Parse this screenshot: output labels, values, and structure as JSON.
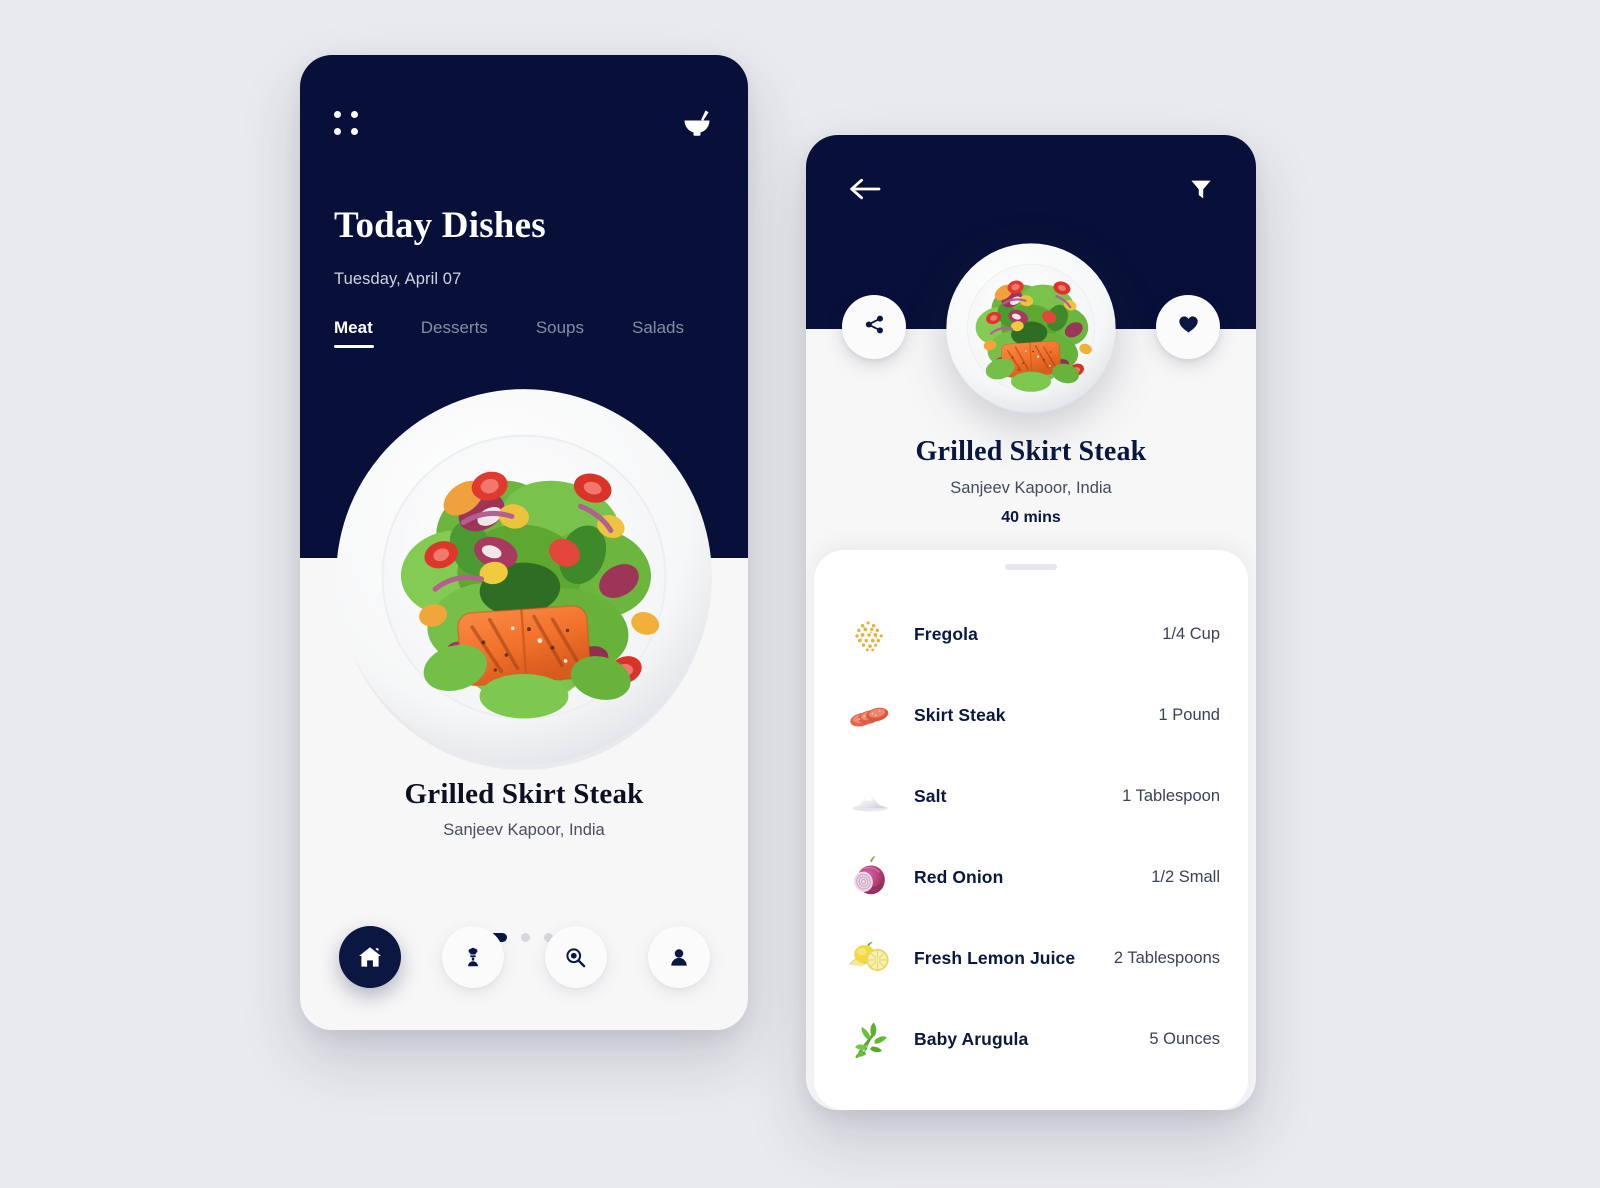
{
  "theme": {
    "navy": "#081039",
    "navy_text": "#0b1740",
    "page_bg": "#e9eaee",
    "card_bg": "#f7f7f8",
    "muted_tab": "#848da8"
  },
  "home_screen": {
    "menu_icon": "grid-dots-icon",
    "bowl_icon": "bowl-with-spoon-icon",
    "title": "Today Dishes",
    "date": "Tuesday, April 07",
    "tabs": [
      {
        "label": "Meat",
        "active": true
      },
      {
        "label": "Desserts",
        "active": false
      },
      {
        "label": "Soups",
        "active": false
      },
      {
        "label": "Salads",
        "active": false
      }
    ],
    "dish": {
      "name": "Grilled Skirt Steak",
      "author": "Sanjeev Kapoor, India",
      "image_alt": "grilled-salmon-salad-plate"
    },
    "carousel": {
      "total": 4,
      "active_index": 0
    },
    "bottom_nav": [
      {
        "icon": "home-icon",
        "active": true
      },
      {
        "icon": "chef-icon",
        "active": false
      },
      {
        "icon": "search-icon",
        "active": false
      },
      {
        "icon": "profile-icon",
        "active": false
      }
    ]
  },
  "detail_screen": {
    "back_icon": "arrow-left-icon",
    "filter_icon": "filter-funnel-icon",
    "share_icon": "share-icon",
    "favorite_icon": "heart-icon",
    "dish": {
      "name": "Grilled Skirt Steak",
      "author": "Sanjeev Kapoor, India",
      "time": "40 mins",
      "image_alt": "grilled-salmon-salad-plate"
    },
    "ingredients": [
      {
        "icon": "fregola-icon",
        "name": "Fregola",
        "quantity": "1/4 Cup"
      },
      {
        "icon": "skirt-steak-icon",
        "name": "Skirt Steak",
        "quantity": "1 Pound"
      },
      {
        "icon": "salt-icon",
        "name": "Salt",
        "quantity": "1 Tablespoon"
      },
      {
        "icon": "red-onion-icon",
        "name": "Red Onion",
        "quantity": "1/2 Small"
      },
      {
        "icon": "lemon-icon",
        "name": "Fresh Lemon Juice",
        "quantity": "2 Tablespoons"
      },
      {
        "icon": "arugula-icon",
        "name": "Baby Arugula",
        "quantity": "5 Ounces"
      }
    ]
  }
}
